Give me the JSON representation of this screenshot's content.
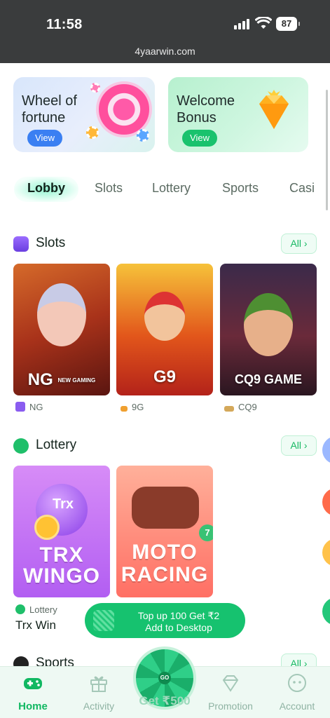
{
  "status_bar": {
    "time": "11:58",
    "battery": "87",
    "url": "4yaarwin.com"
  },
  "banners": [
    {
      "title": "Wheel of fortune",
      "button": "View"
    },
    {
      "title": "Welcome Bonus",
      "button": "View"
    }
  ],
  "tabs": [
    "Lobby",
    "Slots",
    "Lottery",
    "Sports",
    "Casi"
  ],
  "slots": {
    "title": "Slots",
    "all_label": "All ›",
    "games": [
      {
        "brand": "NG",
        "caption": "NG"
      },
      {
        "brand": "G9",
        "caption": "9G"
      },
      {
        "brand": "CQ9 GAME",
        "caption": "CQ9"
      }
    ],
    "ng_sub": "NEW GAMING"
  },
  "lottery": {
    "title": "Lottery",
    "all_label": "All ›",
    "games": [
      {
        "line1": "TRX",
        "line2": "WINGO",
        "badge": "Trx"
      },
      {
        "line1": "MOTO",
        "line2": "RACING",
        "badge": "7"
      }
    ],
    "caption_category": "Lottery",
    "caption_title": "Trx Win"
  },
  "sports": {
    "title": "Sports",
    "all_label": "All ›"
  },
  "topup": {
    "line1": "Top up 100 Get ₹2",
    "line2": "Add to Desktop"
  },
  "bottom_nav": {
    "items": [
      "Home",
      "Activity",
      "Promotion",
      "Account"
    ],
    "center_label": "Get ₹500",
    "center_badge": "GO"
  },
  "colors": {
    "accent": "#16c26f",
    "brand_green": "#11b862",
    "status_bar": "#3a3c3d"
  }
}
